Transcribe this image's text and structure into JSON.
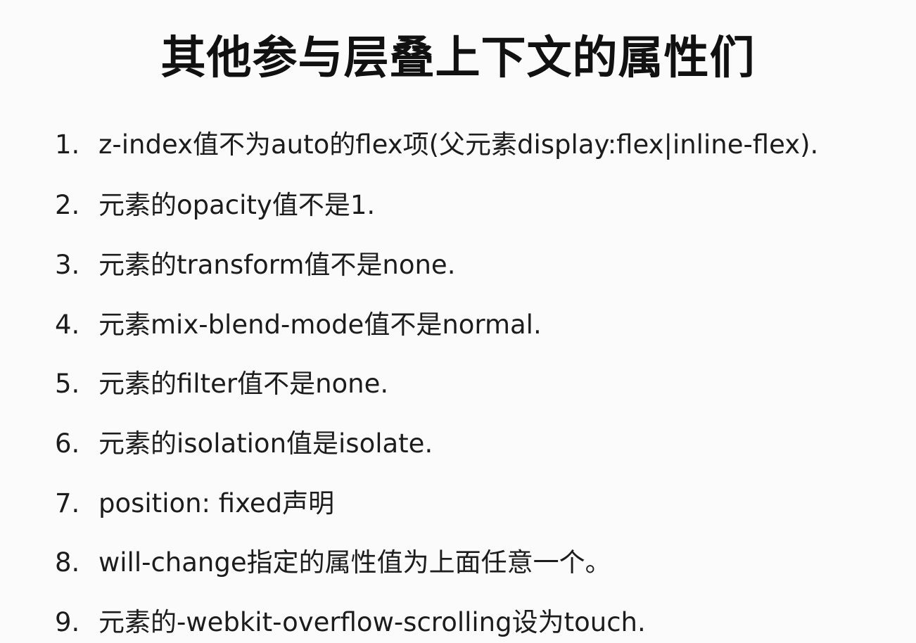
{
  "slide": {
    "title": "其他参与层叠上下文的属性们",
    "items": [
      {
        "number": "1.",
        "text": "z-index值不为auto的flex项(父元素display:flex|inline-flex)."
      },
      {
        "number": "2.",
        "text": "元素的opacity值不是1."
      },
      {
        "number": "3.",
        "text": "元素的transform值不是none."
      },
      {
        "number": "4.",
        "text": "元素mix-blend-mode值不是normal."
      },
      {
        "number": "5.",
        "text": "元素的filter值不是none."
      },
      {
        "number": "6.",
        "text": "元素的isolation值是isolate."
      },
      {
        "number": "7.",
        "text": "position: fixed声明"
      },
      {
        "number": "8.",
        "text": "will-change指定的属性值为上面任意一个。"
      },
      {
        "number": "9.",
        "text": "元素的-webkit-overflow-scrolling设为touch."
      }
    ]
  }
}
